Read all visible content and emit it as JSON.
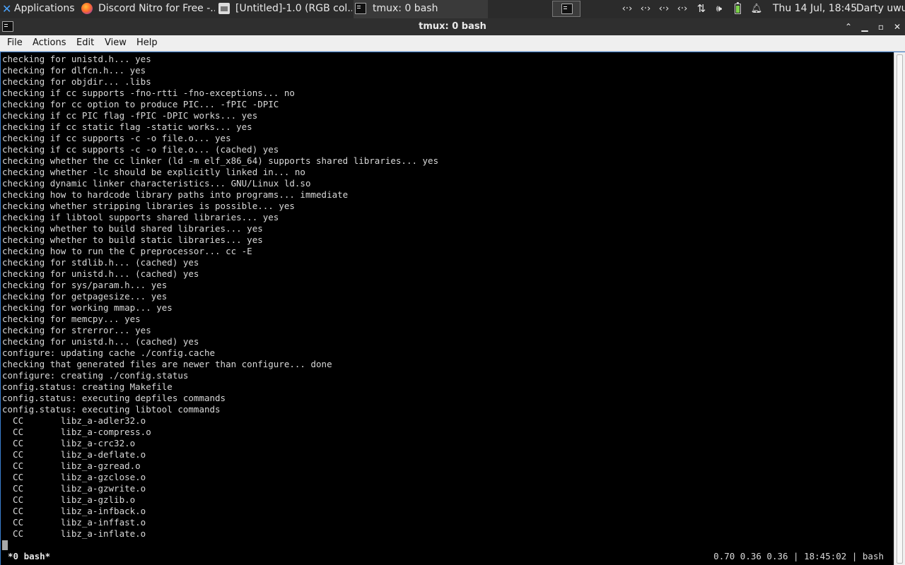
{
  "panel": {
    "applications_label": "Applications",
    "tasks": [
      {
        "label": "Discord Nitro for Free -..."
      },
      {
        "label": "[Untitled]-1.0 (RGB col..."
      },
      {
        "label": "tmux: 0 bash"
      }
    ],
    "tray_icons": [
      "network-icon",
      "network-icon",
      "network-icon",
      "network-icon",
      "transfer-icon",
      "volume-icon",
      "battery-icon",
      "bell-icon"
    ],
    "clock": "Thu 14 Jul, 18:45",
    "user": "Darty uwu"
  },
  "window": {
    "title": "tmux: 0 bash",
    "controls": [
      "maximize-up",
      "minimize",
      "restore",
      "close"
    ]
  },
  "menubar": {
    "file": "File",
    "actions": "Actions",
    "edit": "Edit",
    "view": "View",
    "help": "Help"
  },
  "terminal": {
    "lines": [
      "checking for unistd.h... yes",
      "checking for dlfcn.h... yes",
      "checking for objdir... .libs",
      "checking if cc supports -fno-rtti -fno-exceptions... no",
      "checking for cc option to produce PIC... -fPIC -DPIC",
      "checking if cc PIC flag -fPIC -DPIC works... yes",
      "checking if cc static flag -static works... yes",
      "checking if cc supports -c -o file.o... yes",
      "checking if cc supports -c -o file.o... (cached) yes",
      "checking whether the cc linker (ld -m elf_x86_64) supports shared libraries... yes",
      "checking whether -lc should be explicitly linked in... no",
      "checking dynamic linker characteristics... GNU/Linux ld.so",
      "checking how to hardcode library paths into programs... immediate",
      "checking whether stripping libraries is possible... yes",
      "checking if libtool supports shared libraries... yes",
      "checking whether to build shared libraries... yes",
      "checking whether to build static libraries... yes",
      "checking how to run the C preprocessor... cc -E",
      "checking for stdlib.h... (cached) yes",
      "checking for unistd.h... (cached) yes",
      "checking for sys/param.h... yes",
      "checking for getpagesize... yes",
      "checking for working mmap... yes",
      "checking for memcpy... yes",
      "checking for strerror... yes",
      "checking for unistd.h... (cached) yes",
      "configure: updating cache ./config.cache",
      "checking that generated files are newer than configure... done",
      "configure: creating ./config.status",
      "config.status: creating Makefile",
      "config.status: executing depfiles commands",
      "config.status: executing libtool commands",
      "  CC       libz_a-adler32.o",
      "  CC       libz_a-compress.o",
      "  CC       libz_a-crc32.o",
      "  CC       libz_a-deflate.o",
      "  CC       libz_a-gzread.o",
      "  CC       libz_a-gzclose.o",
      "  CC       libz_a-gzwrite.o",
      "  CC       libz_a-gzlib.o",
      "  CC       libz_a-infback.o",
      "  CC       libz_a-inffast.o",
      "  CC       libz_a-inflate.o"
    ],
    "status_left": "*0 bash*",
    "status_right": "0.70 0.36 0.36 | 18:45:02 | bash"
  }
}
